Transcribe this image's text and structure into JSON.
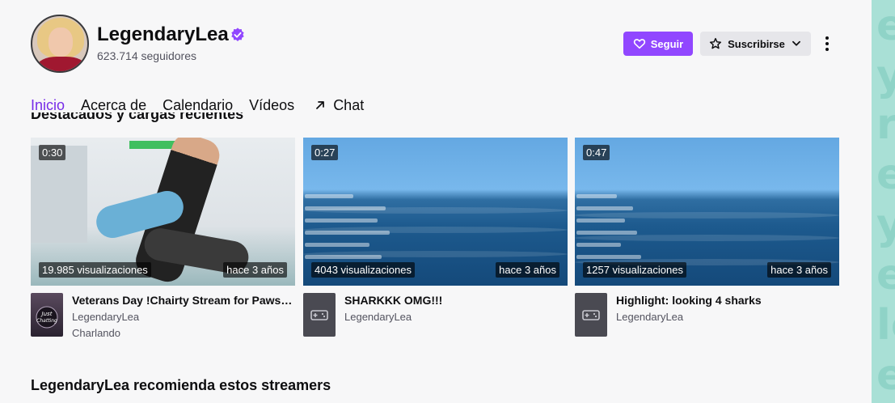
{
  "channel": {
    "name": "LegendaryLea",
    "followers": "623.714 seguidores"
  },
  "actions": {
    "follow_label": "Seguir",
    "subscribe_label": "Suscribirse"
  },
  "tabs": [
    {
      "label": "Inicio",
      "active": true
    },
    {
      "label": "Acerca de"
    },
    {
      "label": "Calendario"
    },
    {
      "label": "Vídeos"
    },
    {
      "label": "Chat",
      "icon": "arrow-up-right-icon"
    }
  ],
  "section": {
    "title": "Destacados y cargas recientes"
  },
  "videos": [
    {
      "duration": "0:30",
      "views": "19.985 visualizaciones",
      "age": "hace 3 años",
      "title": "Veterans Day !Chairty Stream for Paws and Stripes",
      "channel": "LegendaryLea",
      "category": "Charlando",
      "category_image": "just-chatting-icon"
    },
    {
      "duration": "0:27",
      "views": "4043 visualizaciones",
      "age": "hace 3 años",
      "title": "SHARKKK OMG!!!",
      "channel": "LegendaryLea",
      "category_image": "gamepad-icon"
    },
    {
      "duration": "0:47",
      "views": "1257 visualizaciones",
      "age": "hace 3 años",
      "title": "Highlight: looking 4 sharks",
      "channel": "LegendaryLea",
      "category_image": "gamepad-icon"
    }
  ],
  "recommendations": {
    "title": "LegendaryLea recomienda estos streamers"
  },
  "colors": {
    "accent": "#9147ff",
    "active_tab": "#772ce8",
    "side_strip": "#a9e0d6"
  }
}
